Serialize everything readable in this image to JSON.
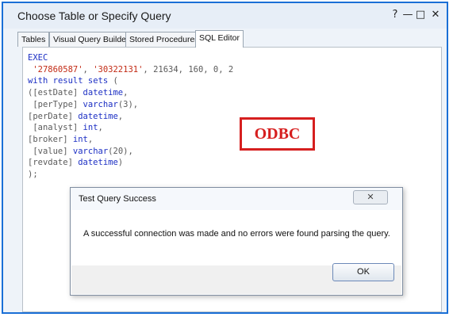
{
  "window": {
    "title": "Choose Table or Specify Query",
    "help_glyph": "?",
    "minimize_glyph": "—",
    "maximize_glyph": "□",
    "close_glyph": "✕"
  },
  "tabs": [
    {
      "label": "Tables"
    },
    {
      "label": "Visual Query Builder"
    },
    {
      "label": "Stored Procedures"
    },
    {
      "label": "SQL Editor"
    }
  ],
  "editor": {
    "lines": [
      "EXEC",
      " '27860587', '30322131', 21634, 160, 0, 2",
      "with result sets (",
      "([estDate] datetime,",
      " [perType] varchar(3),",
      "[perDate] datetime,",
      " [analyst] int,",
      "[broker] int,",
      " [value] varchar(20),",
      "[revdate] datetime)",
      ");"
    ]
  },
  "annotation": {
    "label": "ODBC",
    "color": "#d61f1f"
  },
  "dialog": {
    "title": "Test Query Success",
    "close_glyph": "✕",
    "message": "A successful connection was made and no errors were found parsing the query.",
    "ok_label": "OK"
  },
  "colors": {
    "frame_border": "#1a6fd6",
    "keyword": "#1c2fc4",
    "string": "#c22a14"
  }
}
